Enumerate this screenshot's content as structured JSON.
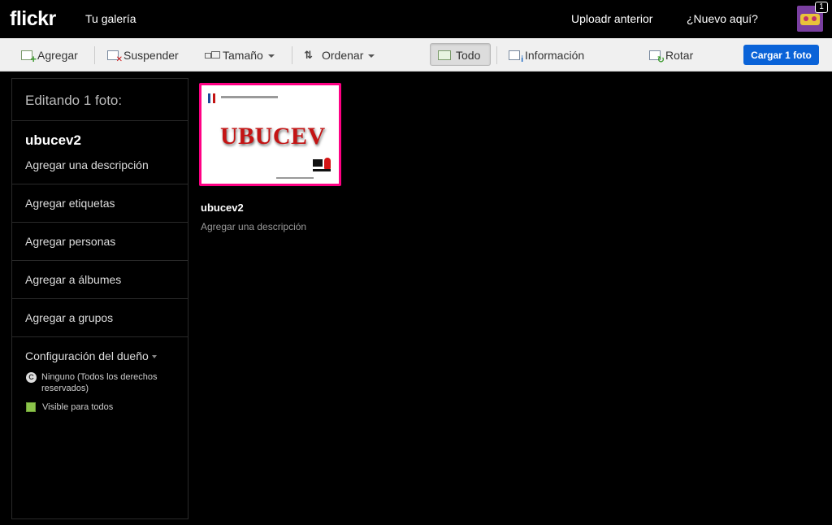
{
  "topbar": {
    "logo": "flickr",
    "gallery_link": "Tu galería",
    "previous_uploader": "Uploadr anterior",
    "new_here": "¿Nuevo aquí?",
    "notification_count": "1"
  },
  "toolbar": {
    "add": "Agregar",
    "suspend": "Suspender",
    "size": "Tamaño",
    "sort": "Ordenar",
    "all": "Todo",
    "info": "Información",
    "rotate": "Rotar",
    "upload": "Cargar 1 foto"
  },
  "sidebar": {
    "heading": "Editando 1 foto:",
    "photo_title": "ubucev2",
    "add_description": "Agregar una descripción",
    "add_tags": "Agregar etiquetas",
    "add_people": "Agregar personas",
    "add_albums": "Agregar a álbumes",
    "add_groups": "Agregar a grupos",
    "owner_settings": "Configuración del dueño",
    "license_icon": "C",
    "license_line1": "Ninguno (Todos los derechos",
    "license_line2": "reservados)",
    "visibility": "Visible para todos"
  },
  "photo": {
    "brand_text": "UBUCEV",
    "title": "ubucev2",
    "description_placeholder": "Agregar una descripción",
    "selected_border_color": "#ff0084"
  },
  "colors": {
    "upload_button": "#0a63d8",
    "background": "#000000",
    "toolbar": "#f0f0f0"
  }
}
